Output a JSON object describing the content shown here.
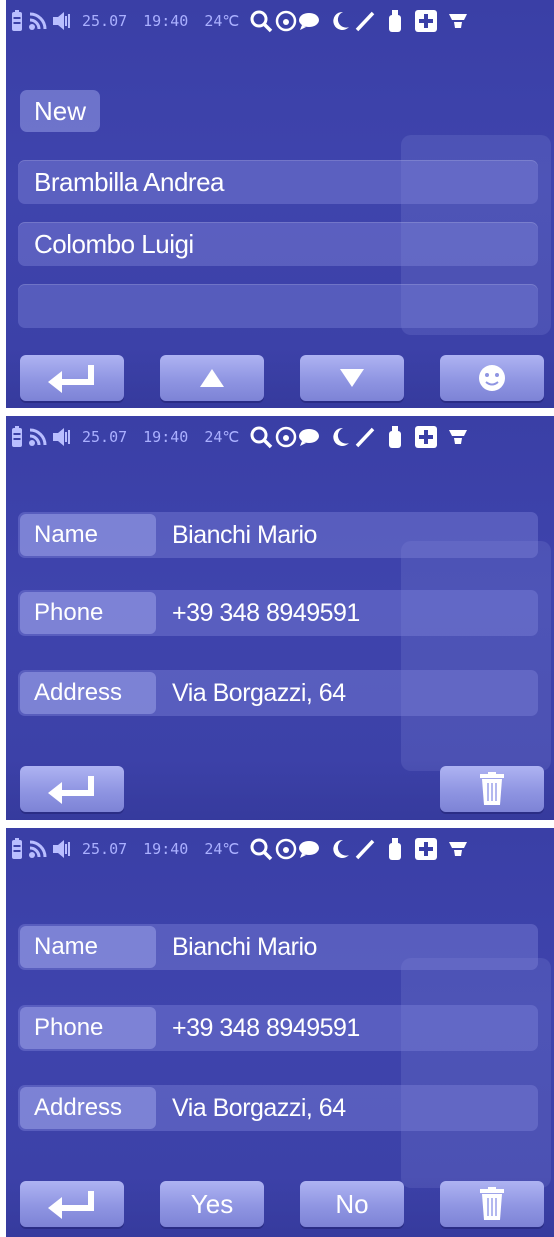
{
  "status": {
    "date": "25.07",
    "time": "19:40",
    "temperature": "24℃",
    "icons": [
      "battery-icon",
      "signal-icon",
      "speaker-icon",
      "search-icon",
      "camera-icon",
      "chat-icon",
      "moon-icon",
      "pen-icon",
      "bottle-icon",
      "plus-icon",
      "settings-icon"
    ]
  },
  "screen1": {
    "new_label": "New",
    "contacts": [
      "Brambilla Andrea",
      "Colombo Luigi",
      ""
    ]
  },
  "screen2": {
    "fields": [
      {
        "label": "Name",
        "value": "Bianchi Mario"
      },
      {
        "label": "Phone",
        "value": "+39 348 8949591"
      },
      {
        "label": "Address",
        "value": "Via Borgazzi, 64"
      }
    ]
  },
  "screen3": {
    "fields": [
      {
        "label": "Name",
        "value": "Bianchi Mario"
      },
      {
        "label": "Phone",
        "value": "+39 348 8949591"
      },
      {
        "label": "Address",
        "value": "Via Borgazzi, 64"
      }
    ],
    "yes_label": "Yes",
    "no_label": "No"
  },
  "colors": {
    "background": "#3d42aa",
    "row": "#7a80d4",
    "button": "#9aa0ea",
    "text": "#ffffff"
  }
}
